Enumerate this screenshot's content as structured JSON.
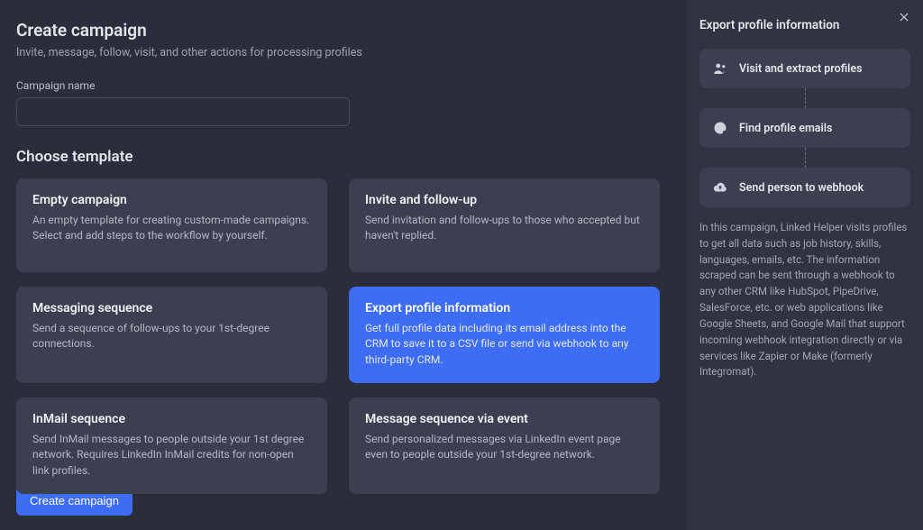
{
  "header": {
    "title": "Create campaign",
    "subtitle": "Invite, message, follow, visit, and other actions for processing profiles"
  },
  "form": {
    "name_label": "Campaign name",
    "name_value": ""
  },
  "templates_section": {
    "title": "Choose template"
  },
  "templates": [
    {
      "title": "Empty campaign",
      "desc": "An empty template for creating custom-made campaigns. Select and add steps to the workflow by yourself.",
      "selected": false
    },
    {
      "title": "Invite and follow-up",
      "desc": "Send invitation and follow-ups to those who accepted but haven't replied.",
      "selected": false
    },
    {
      "title": "Messaging sequence",
      "desc": "Send a sequence of follow-ups to your 1st-degree connections.",
      "selected": false
    },
    {
      "title": "Export profile information",
      "desc": "Get full profile data including its email address into the CRM to save it to a CSV file or send via webhook to any third-party CRM.",
      "selected": true
    },
    {
      "title": "InMail sequence",
      "desc": "Send InMail messages to people outside your 1st degree network. Requires LinkedIn InMail credits for non-open link profiles.",
      "selected": false
    },
    {
      "title": "Message sequence via event",
      "desc": "Send personalized messages via LinkedIn event page even to people outside your 1st-degree network.",
      "selected": false
    }
  ],
  "footer": {
    "create_label": "Create campaign"
  },
  "sidepanel": {
    "title": "Export profile information",
    "steps": [
      {
        "icon": "people-icon",
        "label": "Visit and extract profiles"
      },
      {
        "icon": "at-icon",
        "label": "Find profile emails"
      },
      {
        "icon": "cloud-icon",
        "label": "Send person to webhook"
      }
    ],
    "description": "In this campaign, Linked Helper visits profiles to get all data such as job history, skills, languages, emails, etc. The information scraped can be sent through a webhook to any other CRM like HubSpot, PipeDrive, SalesForce, etc. or web applications like Google Sheets, and Google Mail that support incoming webhook integration directly or via services like Zapier or Make (formerly Integromat)."
  }
}
